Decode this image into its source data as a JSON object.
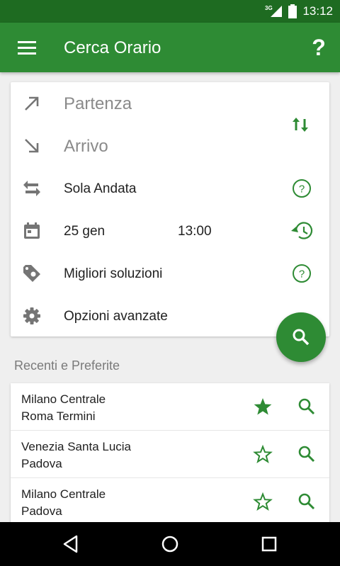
{
  "status_bar": {
    "network_label": "3G",
    "time": "13:12",
    "icons": [
      "signal-icon",
      "battery-icon"
    ]
  },
  "app_bar": {
    "title": "Cerca Orario",
    "menu_icon": "hamburger-menu-icon",
    "help_label": "?"
  },
  "search_form": {
    "departure_placeholder": "Partenza",
    "arrival_placeholder": "Arrivo",
    "trip_type": "Sola Andata",
    "date": "25 gen",
    "time": "13:00",
    "solutions": "Migliori soluzioni",
    "advanced": "Opzioni avanzate"
  },
  "recent": {
    "title": "Recenti e Preferite",
    "items": [
      {
        "from": "Milano Centrale",
        "to": "Roma Termini",
        "favorite": true
      },
      {
        "from": "Venezia Santa Lucia",
        "to": "Padova",
        "favorite": false
      },
      {
        "from": "Milano Centrale",
        "to": "Padova",
        "favorite": false
      }
    ]
  },
  "colors": {
    "primary": "#2e8b34",
    "primary_dark": "#1e6b21",
    "accent_icon": "#2e8b34",
    "text": "#212121",
    "secondary_text": "#7a7a7a"
  }
}
